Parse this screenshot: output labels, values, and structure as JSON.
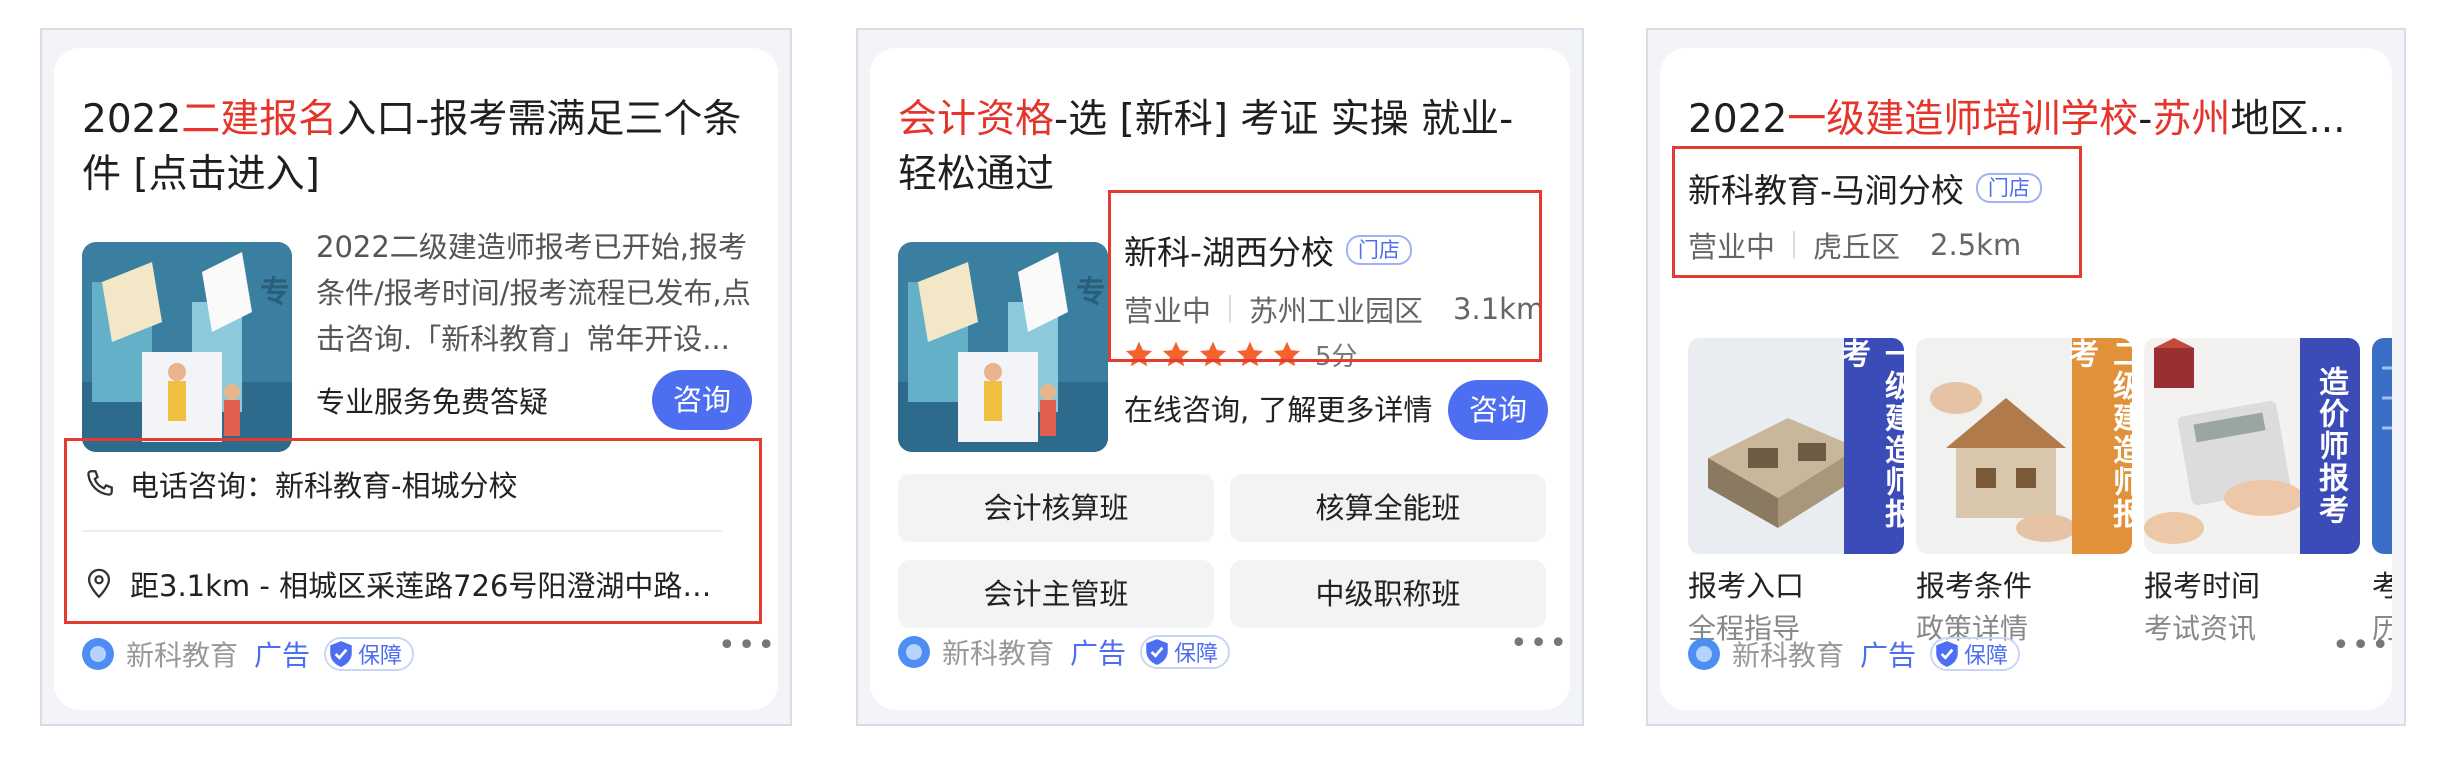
{
  "card1": {
    "title_pre": "2022",
    "title_hl": "二建报名",
    "title_post": "入口-报考需满足三个条件 [点击进入]",
    "description": "2022二级建造师报考已开始,报考条件/报考时间/报考流程已发布,点击咨询.「新科教育」常年开设...",
    "slogan": "专业服务免费答疑",
    "consult_label": "咨询",
    "phone_text": "电话咨询：新科教育-相城分校",
    "address_text": "距3.1km - 相城区采莲路726号阳澄湖中路地...",
    "footer": {
      "brand": "新科教育",
      "ad": "广告",
      "badge": "保障"
    }
  },
  "card2": {
    "title_hl": "会计资格",
    "title_post": "-选 [新科] 考证 实操 就业-轻松通过",
    "store_name": "新科-湖西分校",
    "store_tag": "门店",
    "status": "营业中",
    "district": "苏州工业园区",
    "distance": "3.1km",
    "rating": 5,
    "rating_text": "5分",
    "slogan": "在线咨询, 了解更多详情",
    "consult_label": "咨询",
    "chips": [
      "会计核算班",
      "核算全能班",
      "会计主管班",
      "中级职称班"
    ],
    "footer": {
      "brand": "新科教育",
      "ad": "广告",
      "badge": "保障"
    }
  },
  "card3": {
    "title_pre": "2022",
    "title_hl": "一级建造师培训学校",
    "title_mid": "-",
    "title_hl2": "苏州",
    "title_post": "地区...",
    "store_name": "新科教育-马涧分校",
    "store_tag": "门店",
    "status": "营业中",
    "district": "虎丘区",
    "distance": "2.5km",
    "tiles": [
      {
        "label": "一级建造师报考",
        "color": "#3b4bb8",
        "title": "报考入口",
        "sub": "全程指导"
      },
      {
        "label": "二级建造师报考",
        "color": "#e0913a",
        "title": "报考条件",
        "sub": "政策详情"
      },
      {
        "label": "造价师报考",
        "color": "#3b4bb8",
        "title": "报考时间",
        "sub": "考试资讯"
      },
      {
        "label": "",
        "color": "#3b6fc7",
        "title": "考",
        "sub": "历"
      }
    ],
    "footer": {
      "brand": "新科教育",
      "ad": "广告",
      "badge": "保障"
    }
  },
  "colors": {
    "highlight": "#e5352b",
    "brand_blue": "#4e6ef2",
    "star": "#f5622d",
    "annotation_box": "#e23b32"
  }
}
